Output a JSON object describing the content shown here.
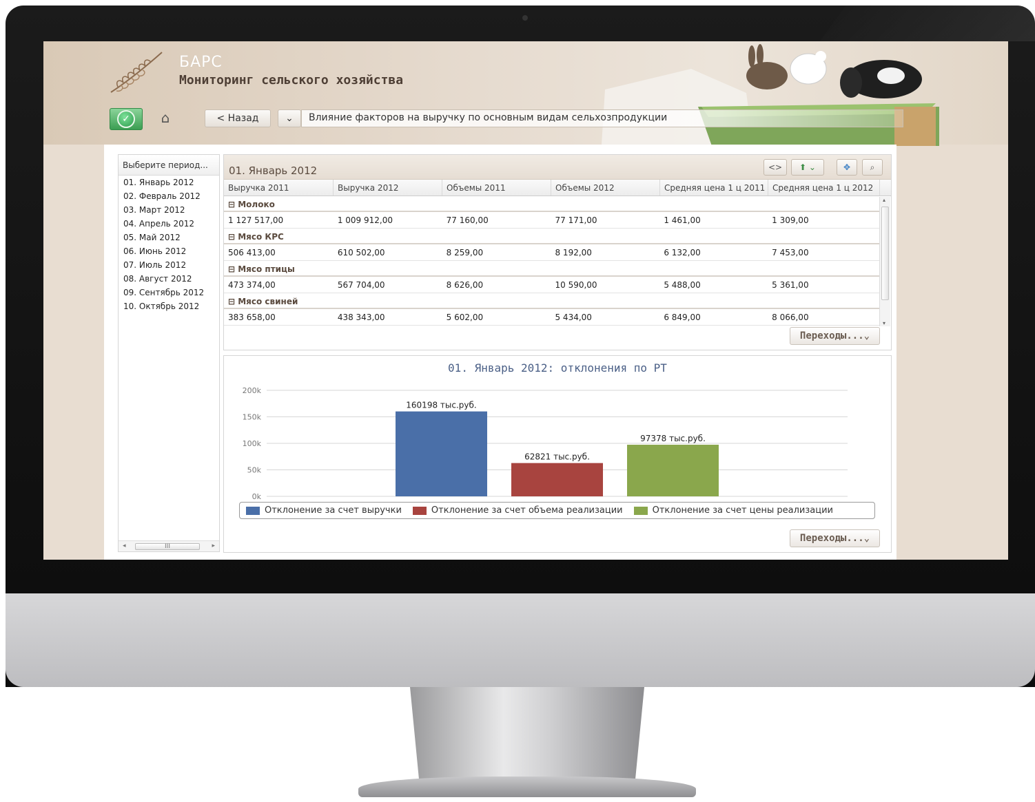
{
  "header": {
    "brand": "БАРС",
    "subtitle": "Мониторинг сельского хозяйства"
  },
  "toolbar": {
    "home_icon": "⌂",
    "back_label": "< Назад",
    "dropdown_icon": "⌄",
    "breadcrumb": "Влияние факторов на выручку по основным видам сельхозпродукции"
  },
  "periods": {
    "header": "Выберите период...",
    "items": [
      "01. Январь 2012",
      "02. Февраль 2012",
      "03. Март 2012",
      "04. Апрель 2012",
      "05. Май 2012",
      "06. Июнь 2012",
      "07. Июль 2012",
      "08. Август 2012",
      "09. Сентябрь 2012",
      "10. Октябрь 2012"
    ],
    "scroll_thumb": "III"
  },
  "grid": {
    "title": "01. Январь 2012",
    "columns": [
      "Выручка 2011",
      "Выручка 2012",
      "Объемы 2011",
      "Объемы 2012",
      "Средняя цена 1 ц 2011",
      "Средняя цена 1 ц 2012"
    ],
    "groups": [
      {
        "name": "⊟ Молоко",
        "values": [
          "1 127 517,00",
          "1 009 912,00",
          "77 160,00",
          "77 171,00",
          "1 461,00",
          "1 309,00"
        ]
      },
      {
        "name": "⊟ Мясо КРС",
        "values": [
          "506 413,00",
          "610 502,00",
          "8 259,00",
          "8 192,00",
          "6 132,00",
          "7 453,00"
        ]
      },
      {
        "name": "⊟ Мясо птицы",
        "values": [
          "473 374,00",
          "567 704,00",
          "8 626,00",
          "10 590,00",
          "5 488,00",
          "5 361,00"
        ]
      },
      {
        "name": "⊟ Мясо свиней",
        "values": [
          "383 658,00",
          "438 343,00",
          "5 602,00",
          "5 434,00",
          "6 849,00",
          "8 066,00"
        ]
      }
    ],
    "nav_label": "Переходы...⌄"
  },
  "chart_nav_label": "Переходы...⌄",
  "chart_data": {
    "type": "bar",
    "title": "01. Январь 2012: отклонения по РТ",
    "ylim": [
      0,
      200000
    ],
    "yticks": [
      "0k",
      "50k",
      "100k",
      "150k",
      "200k"
    ],
    "series": [
      {
        "name": "Отклонение за счет выручки",
        "values": [
          160198
        ],
        "label": "160198 тыс.руб.",
        "color": "#4a6fa8"
      },
      {
        "name": "Отклонение за счет объема реализации",
        "values": [
          62821
        ],
        "label": "62821 тыс.руб.",
        "color": "#a8443f"
      },
      {
        "name": "Отклонение за счет цены реализации",
        "values": [
          97378
        ],
        "label": "97378 тыс.руб.",
        "color": "#8aa74c"
      }
    ],
    "legend": "bottom",
    "grid": true
  }
}
